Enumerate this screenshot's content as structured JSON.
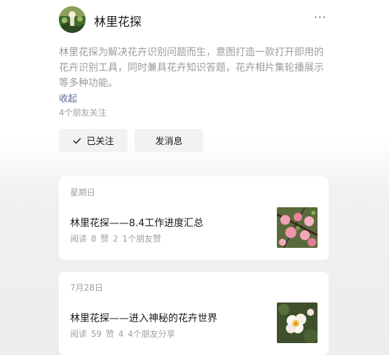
{
  "profile": {
    "name": "林里花探",
    "more_label": "···",
    "description": "林里花探为解决花卉识别问题而生，意图打造一款打开即用的花卉识别工具，同时兼具花卉知识答题，花卉相片集轮播展示等多种功能。",
    "collapse_label": "收起",
    "friends_text": "4个朋友关注",
    "follow_label": "已关注",
    "message_label": "发消息"
  },
  "articles": [
    {
      "date": "星期日",
      "title": "林里花探——8.4工作进度汇总",
      "meta": "阅读 8  赞 2  1个朋友赞",
      "thumb_icon": "pink-blossom-thumbnail"
    },
    {
      "date": "7月28日",
      "title": "林里花探——进入神秘的花卉世界",
      "meta": "阅读 59  赞 4  4个朋友分享",
      "thumb_icon": "white-flower-thumbnail"
    }
  ],
  "colors": {
    "link": "#576b95",
    "muted": "#9b9b9b",
    "button_bg": "#f2f2f2"
  }
}
